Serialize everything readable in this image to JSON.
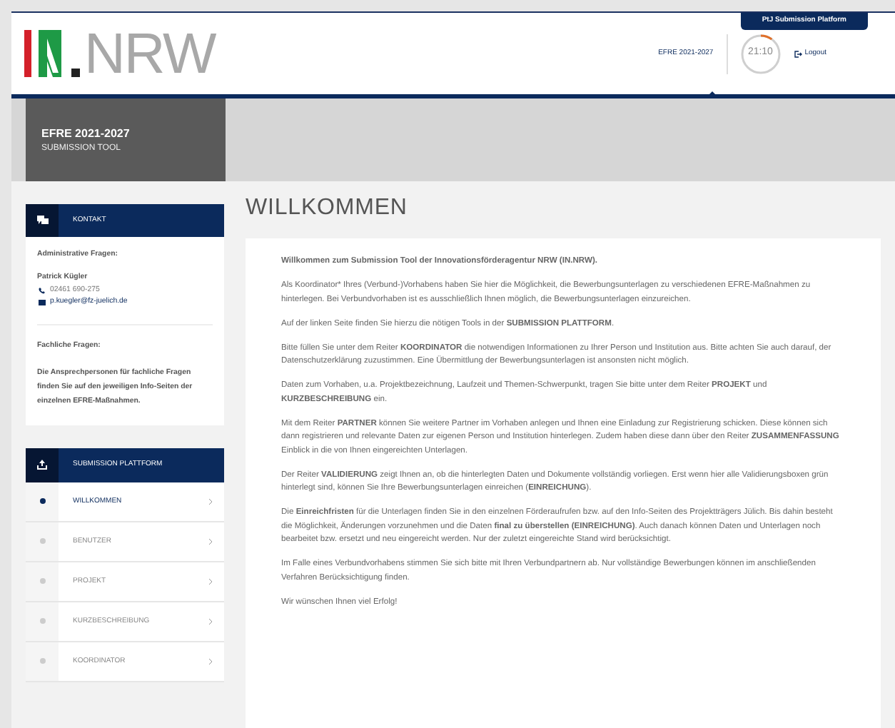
{
  "header": {
    "logo_text": "NRW",
    "platform_tab": "PtJ Submission Platform",
    "program_link": "EFRE 2021-2027",
    "timer": {
      "time": "21:10",
      "level": 0.1
    },
    "logout": "Logout"
  },
  "banner": {
    "title": "EFRE 2021-2027",
    "subtitle": "SUBMISSION TOOL"
  },
  "contact": {
    "title": "KONTAKT",
    "admin_heading": "Administrative Fragen:",
    "name": "Patrick Kügler",
    "phone": "02461 690-275",
    "email": "p.kuegler@fz-juelich.de",
    "tech_heading": "Fachliche Fragen:",
    "tech_text": "Die Ansprechpersonen für fachliche Fragen finden Sie auf den jeweiligen Info-Seiten der einzelnen EFRE-Maßnahmen."
  },
  "submission_nav": {
    "title": "SUBMISSION PLATTFORM",
    "items": [
      {
        "label": "WILLKOMMEN",
        "selected": true
      },
      {
        "label": "BENUTZER",
        "selected": false
      },
      {
        "label": "PROJEKT",
        "selected": false
      },
      {
        "label": "KURZBESCHREIBUNG",
        "selected": false
      },
      {
        "label": "KOORDINATOR",
        "selected": false
      }
    ]
  },
  "main": {
    "heading": "WILLKOMMEN",
    "paragraphs": [
      "**Willkommen zum Submission Tool der Innovationsförderagentur NRW (IN.NRW).**",
      "Als Koordinator* Ihres (Verbund-)Vorhabens haben Sie hier die Möglichkeit, die Bewerbungsunterlagen zu verschiedenen EFRE-Maßnahmen zu hinterlegen. Bei Verbundvorhaben ist es ausschließlich Ihnen möglich, die Bewerbungsunterlagen einzureichen.",
      "Auf der linken Seite finden Sie hierzu die nötigen Tools in der **SUBMISSION PLATTFORM**.",
      "Bitte füllen Sie unter dem Reiter **KOORDINATOR** die notwendigen Informationen zu Ihrer Person und Institution aus. Bitte achten Sie auch darauf, der Datenschutzerklärung zuzustimmen. Eine Übermittlung der Bewerbungsunterlagen ist ansonsten nicht möglich.",
      "Daten zum Vorhaben, u.a. Projektbezeichnung, Laufzeit und Themen-Schwerpunkt, tragen Sie bitte unter dem Reiter **PROJEKT** und **KURZBESCHREIBUNG** ein.",
      "Mit dem Reiter **PARTNER** können Sie weitere Partner im Vorhaben anlegen und Ihnen eine Einladung zur Registrierung schicken. Diese können sich dann registrieren und relevante Daten zur eigenen Person und Institution hinterlegen. Zudem haben diese dann über den Reiter **ZUSAMMENFASSUNG** Einblick in die von Ihnen eingereichten Unterlagen.",
      "Der Reiter **VALIDIERUNG** zeigt Ihnen an, ob die hinterlegten Daten und Dokumente vollständig vorliegen. Erst wenn hier alle Validierungsboxen grün hinterlegt sind, können Sie Ihre Bewerbungsunterlagen einreichen (**EINREICHUNG**).",
      "Die **Einreichfristen** für die Unterlagen finden Sie in den einzelnen Förderaufrufen bzw. auf den Info-Seiten des Projektträgers Jülich. Bis dahin besteht die Möglichkeit, Änderungen vorzunehmen und die Daten **final zu überstellen (EINREICHUNG)**. Auch danach können Daten und Unterlagen noch bearbeitet bzw. ersetzt und neu eingereicht werden. Nur der zuletzt eingereichte Stand wird berücksichtigt.",
      "Im Falle eines Verbundvorhabens stimmen Sie sich bitte mit Ihren Verbundpartnern ab. Nur vollständige Bewerbungen können im anschließenden Verfahren Berücksichtigung finden.",
      "Wir wünschen Ihnen viel Erfolg!"
    ]
  }
}
